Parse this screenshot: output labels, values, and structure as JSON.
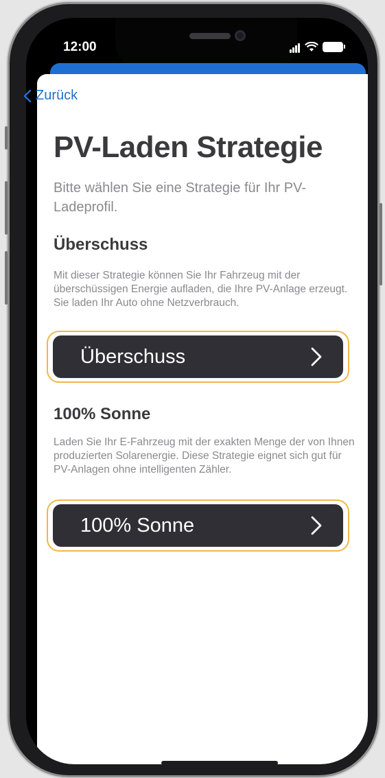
{
  "status_bar": {
    "time": "12:00"
  },
  "nav": {
    "back_label": "Zurück"
  },
  "page": {
    "title": "PV-Laden Strategie",
    "subtitle": "Bitte wählen Sie eine Strategie für Ihr PV-Ladeprofil."
  },
  "sections": [
    {
      "heading": "Überschuss",
      "description": "Mit dieser Strategie können Sie Ihr Fahrzeug mit der überschüssigen Energie aufladen, die Ihre PV-Anlage erzeugt. Sie laden Ihr Auto ohne Netzverbrauch.",
      "button_label": "Überschuss"
    },
    {
      "heading": "100% Sonne",
      "description": "Laden Sie Ihr E-Fahrzeug mit der exakten Menge der von Ihnen produzierten Solarenergie. Diese Strategie eignet sich gut für PV-Anlagen ohne intelligenten Zähler.",
      "button_label": "100% Sonne"
    }
  ],
  "colors": {
    "accent": "#1f6fd1",
    "button_bg": "#2f2f35",
    "highlight_border": "#f2b64a"
  }
}
